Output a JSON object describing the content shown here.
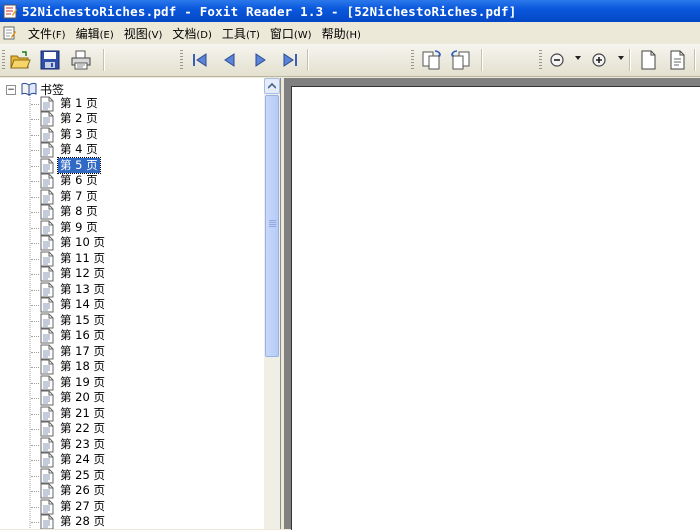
{
  "window": {
    "title": "52NichestoRiches.pdf - Foxit Reader 1.3 - [52NichestoRiches.pdf]"
  },
  "menu": [
    {
      "label": "文件",
      "hotkey": "(F)"
    },
    {
      "label": "编辑",
      "hotkey": "(E)"
    },
    {
      "label": "视图",
      "hotkey": "(V)"
    },
    {
      "label": "文档",
      "hotkey": "(D)"
    },
    {
      "label": "工具",
      "hotkey": "(T)"
    },
    {
      "label": "窗口",
      "hotkey": "(W)"
    },
    {
      "label": "帮助",
      "hotkey": "(H)"
    }
  ],
  "toolbar": {
    "icons": [
      "open-folder-icon",
      "save-icon",
      "print-icon",
      "first-page-icon",
      "previous-page-icon",
      "next-page-icon",
      "last-page-icon",
      "rotate-left-icon",
      "rotate-right-icon",
      "zoom-out-icon",
      "zoom-in-icon",
      "single-page-icon",
      "continuous-page-icon"
    ]
  },
  "bookmarks": {
    "root_label": "书签",
    "expander": "−",
    "selected_index": 4,
    "items": [
      "第 1 页",
      "第 2 页",
      "第 3 页",
      "第 4 页",
      "第 5 页",
      "第 6 页",
      "第 7 页",
      "第 8 页",
      "第 9 页",
      "第 10 页",
      "第 11 页",
      "第 12 页",
      "第 13 页",
      "第 14 页",
      "第 15 页",
      "第 16 页",
      "第 17 页",
      "第 18 页",
      "第 19 页",
      "第 20 页",
      "第 21 页",
      "第 22 页",
      "第 23 页",
      "第 24 页",
      "第 25 页",
      "第 26 页",
      "第 27 页",
      "第 28 页"
    ]
  },
  "colors": {
    "titlebar": "#0a58dc",
    "selection": "#316ac5",
    "document_background": "#808080"
  }
}
